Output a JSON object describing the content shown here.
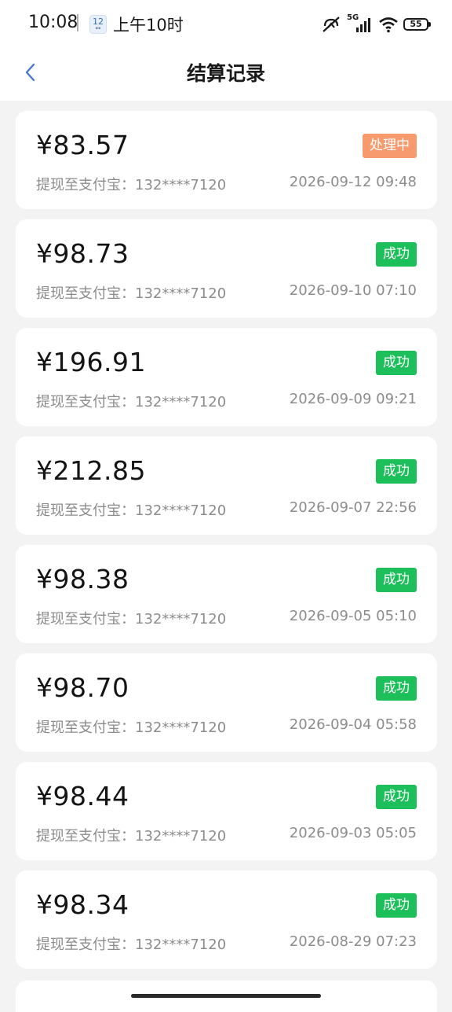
{
  "status_bar": {
    "time": "10:08",
    "calendar_day": "12",
    "reminder": "上午10时",
    "network": "5G",
    "battery": "55"
  },
  "header": {
    "title": "结算记录"
  },
  "records": [
    {
      "amount": "¥83.57",
      "status": "处理中",
      "status_type": "processing",
      "account": "提现至支付宝：132****7120",
      "datetime": "2026-09-12 09:48"
    },
    {
      "amount": "¥98.73",
      "status": "成功",
      "status_type": "success",
      "account": "提现至支付宝：132****7120",
      "datetime": "2026-09-10 07:10"
    },
    {
      "amount": "¥196.91",
      "status": "成功",
      "status_type": "success",
      "account": "提现至支付宝：132****7120",
      "datetime": "2026-09-09 09:21"
    },
    {
      "amount": "¥212.85",
      "status": "成功",
      "status_type": "success",
      "account": "提现至支付宝：132****7120",
      "datetime": "2026-09-07 22:56"
    },
    {
      "amount": "¥98.38",
      "status": "成功",
      "status_type": "success",
      "account": "提现至支付宝：132****7120",
      "datetime": "2026-09-05 05:10"
    },
    {
      "amount": "¥98.70",
      "status": "成功",
      "status_type": "success",
      "account": "提现至支付宝：132****7120",
      "datetime": "2026-09-04 05:58"
    },
    {
      "amount": "¥98.44",
      "status": "成功",
      "status_type": "success",
      "account": "提现至支付宝：132****7120",
      "datetime": "2026-09-03 05:05"
    },
    {
      "amount": "¥98.34",
      "status": "成功",
      "status_type": "success",
      "account": "提现至支付宝：132****7120",
      "datetime": "2026-08-29 07:23"
    }
  ],
  "colors": {
    "processing": "#f79b6f",
    "success": "#1dbf5b",
    "back_arrow": "#4a78c8"
  },
  "icons": {
    "back": "chevron-left-icon",
    "calendar": "calendar-icon",
    "nfc_off": "nfc-off-icon",
    "signal": "signal-icon",
    "wifi": "wifi-icon",
    "battery": "battery-icon"
  }
}
